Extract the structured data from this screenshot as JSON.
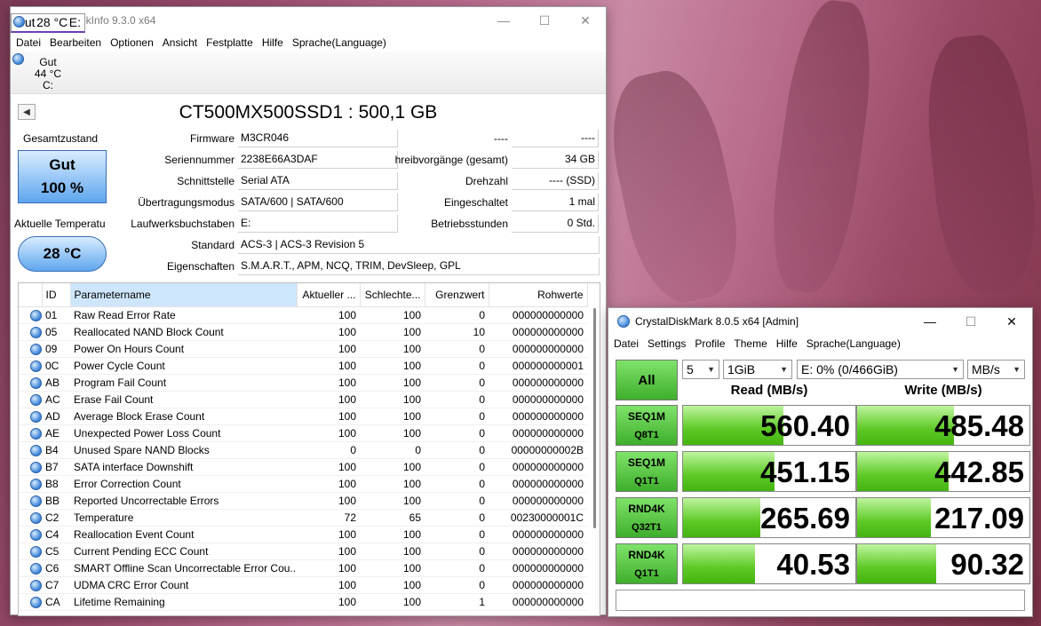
{
  "cdi": {
    "title": "CrystalDiskInfo 9.3.0 x64",
    "menu": [
      "Datei",
      "Bearbeiten",
      "Optionen",
      "Ansicht",
      "Festplatte",
      "Hilfe",
      "Sprache(Language)"
    ],
    "drives": [
      {
        "status": "Gut",
        "temp": "44 °C",
        "letter": "C:"
      },
      {
        "status": "Gut",
        "temp": "28 °C",
        "letter": "E:"
      }
    ],
    "model": "CT500MX500SSD1 : 500,1 GB",
    "health_label": "Gesamtzustand",
    "health_status": "Gut",
    "health_pct": "100 %",
    "temp_label": "Aktuelle Temperatu",
    "temp_value": "28 °C",
    "fields": {
      "firmware_l": "Firmware",
      "firmware": "M3CR046",
      "serial_l": "Seriennummer",
      "serial": "2238E66A3DAF",
      "iface_l": "Schnittstelle",
      "iface": "Serial ATA",
      "mode_l": "Übertragungsmodus",
      "mode": "SATA/600 | SATA/600",
      "letter_l": "Laufwerksbuchstaben",
      "letter": "E:",
      "std_l": "Standard",
      "std": "ACS-3 | ACS-3 Revision 5",
      "feat_l": "Eigenschaften",
      "feat": "S.M.A.R.T., APM, NCQ, TRIM, DevSleep, GPL",
      "r1_l": "----",
      "r1": "----",
      "writes_l": "hreibvorgänge (gesamt)",
      "writes": "34 GB",
      "rpm_l": "Drehzahl",
      "rpm": "---- (SSD)",
      "pon_l": "Eingeschaltet",
      "pon": "1 mal",
      "hours_l": "Betriebsstunden",
      "hours": "0 Std."
    },
    "smart_headers": [
      "ID",
      "Parametername",
      "Aktueller ...",
      "Schlechte...",
      "Grenzwert",
      "Rohwerte"
    ],
    "smart_rows": [
      [
        "01",
        "Raw Read Error Rate",
        "100",
        "100",
        "0",
        "000000000000"
      ],
      [
        "05",
        "Reallocated NAND Block Count",
        "100",
        "100",
        "10",
        "000000000000"
      ],
      [
        "09",
        "Power On Hours Count",
        "100",
        "100",
        "0",
        "000000000000"
      ],
      [
        "0C",
        "Power Cycle Count",
        "100",
        "100",
        "0",
        "000000000001"
      ],
      [
        "AB",
        "Program Fail Count",
        "100",
        "100",
        "0",
        "000000000000"
      ],
      [
        "AC",
        "Erase Fail Count",
        "100",
        "100",
        "0",
        "000000000000"
      ],
      [
        "AD",
        "Average Block Erase Count",
        "100",
        "100",
        "0",
        "000000000000"
      ],
      [
        "AE",
        "Unexpected Power Loss Count",
        "100",
        "100",
        "0",
        "000000000000"
      ],
      [
        "B4",
        "Unused Spare NAND Blocks",
        "0",
        "0",
        "0",
        "00000000002B"
      ],
      [
        "B7",
        "SATA interface Downshift",
        "100",
        "100",
        "0",
        "000000000000"
      ],
      [
        "B8",
        "Error Correction Count",
        "100",
        "100",
        "0",
        "000000000000"
      ],
      [
        "BB",
        "Reported Uncorrectable Errors",
        "100",
        "100",
        "0",
        "000000000000"
      ],
      [
        "C2",
        "Temperature",
        "72",
        "65",
        "0",
        "00230000001C"
      ],
      [
        "C4",
        "Reallocation Event Count",
        "100",
        "100",
        "0",
        "000000000000"
      ],
      [
        "C5",
        "Current Pending ECC Count",
        "100",
        "100",
        "0",
        "000000000000"
      ],
      [
        "C6",
        "SMART Offline Scan Uncorrectable Error Cou...",
        "100",
        "100",
        "0",
        "000000000000"
      ],
      [
        "C7",
        "UDMA CRC Error Count",
        "100",
        "100",
        "0",
        "000000000000"
      ],
      [
        "CA",
        "Lifetime Remaining",
        "100",
        "100",
        "1",
        "000000000000"
      ]
    ]
  },
  "cdm": {
    "title": "CrystalDiskMark 8.0.5 x64 [Admin]",
    "menu": [
      "Datei",
      "Settings",
      "Profile",
      "Theme",
      "Hilfe",
      "Sprache(Language)"
    ],
    "all_label": "All",
    "count": "5",
    "size": "1GiB",
    "drive": "E: 0% (0/466GiB)",
    "unit": "MB/s",
    "read_header": "Read (MB/s)",
    "write_header": "Write (MB/s)",
    "tests": [
      {
        "l1": "SEQ1M",
        "l2": "Q8T1",
        "read": "560.40",
        "write": "485.48",
        "read_fill": 0.58,
        "write_fill": 0.56
      },
      {
        "l1": "SEQ1M",
        "l2": "Q1T1",
        "read": "451.15",
        "write": "442.85",
        "read_fill": 0.53,
        "write_fill": 0.53
      },
      {
        "l1": "RND4K",
        "l2": "Q32T1",
        "read": "265.69",
        "write": "217.09",
        "read_fill": 0.45,
        "write_fill": 0.43
      },
      {
        "l1": "RND4K",
        "l2": "Q1T1",
        "read": "40.53",
        "write": "90.32",
        "read_fill": 0.42,
        "write_fill": 0.46
      }
    ],
    "status": ""
  }
}
